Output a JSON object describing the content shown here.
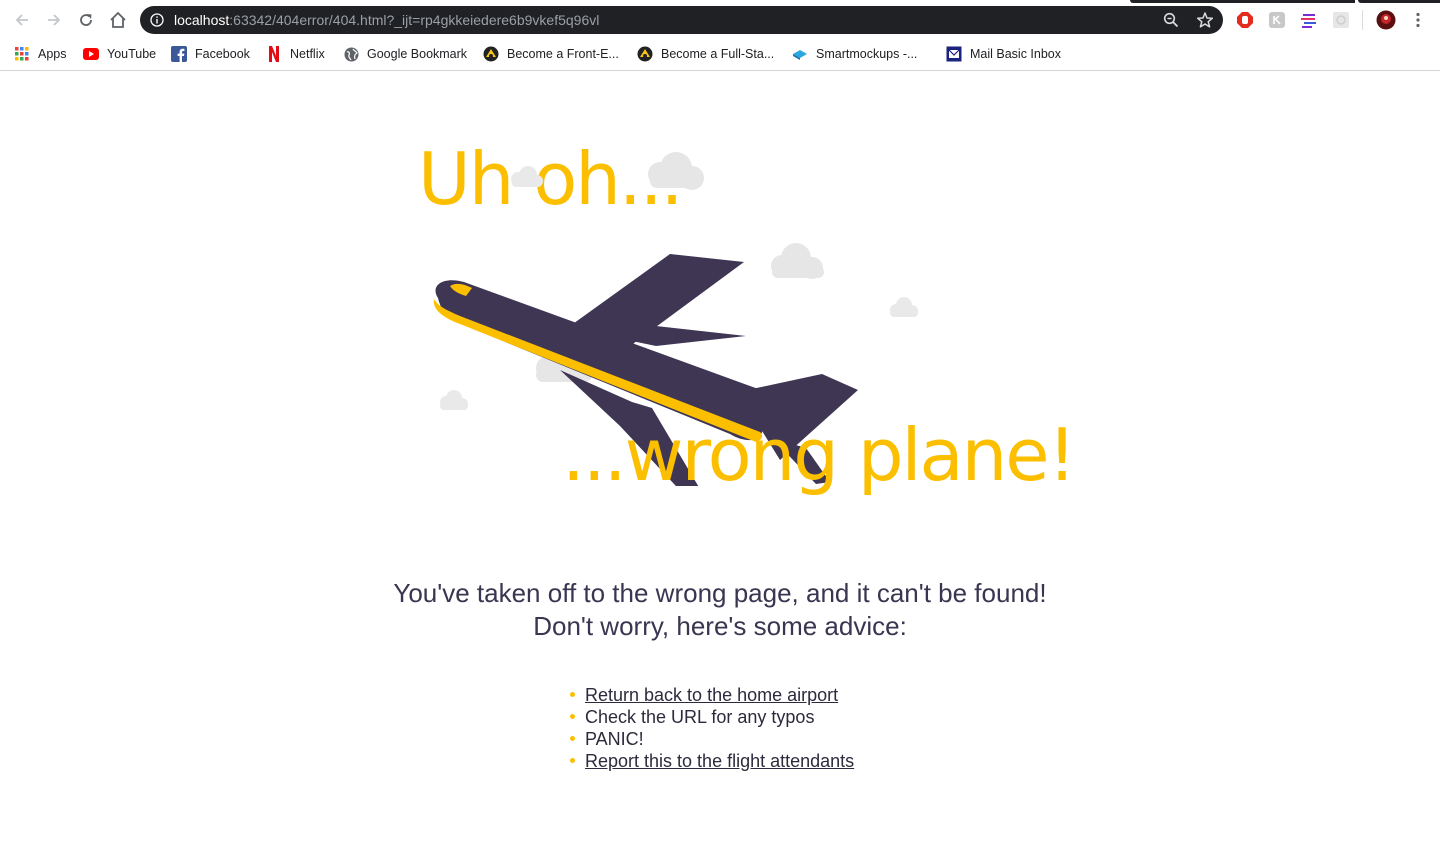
{
  "browser": {
    "url_host": "localhost",
    "url_rest": ":63342/404error/404.html?_ijt=rp4gkkeiedere6b9vkef5q96vl",
    "icons": [
      "back-icon",
      "forward-icon",
      "reload-icon",
      "home-icon",
      "info-icon",
      "zoom-icon",
      "star-icon",
      "menu-icon"
    ]
  },
  "bookmarks": [
    {
      "label": "Apps",
      "icon": "apps-grid-icon"
    },
    {
      "label": "YouTube",
      "icon": "youtube-icon"
    },
    {
      "label": "Facebook",
      "icon": "facebook-icon"
    },
    {
      "label": "Netflix",
      "icon": "netflix-icon"
    },
    {
      "label": "Google Bookmark",
      "icon": "globe-icon"
    },
    {
      "label": "Become a Front-E...",
      "icon": "site-icon"
    },
    {
      "label": "Become a Full-Sta...",
      "icon": "site-icon"
    },
    {
      "label": "Smartmockups -...",
      "icon": "smartmockups-icon"
    },
    {
      "label": "Mail Basic Inbox",
      "icon": "mail-icon"
    }
  ],
  "page": {
    "headline_top": "Uh oh...",
    "headline_bottom": "...wrong plane!",
    "message_line1": "You've taken off to the wrong page, and it can't be found!",
    "message_line2": "Don't worry, here's some advice:",
    "advice": [
      {
        "text": "Return back to the home airport",
        "link": true
      },
      {
        "text": "Check the URL for any typos",
        "link": false
      },
      {
        "text": "PANIC!",
        "link": false
      },
      {
        "text": "Report this to the flight attendants",
        "link": true
      }
    ]
  },
  "colors": {
    "accent": "#fbbf00",
    "plane_body": "#3f3654",
    "text": "#3a3550",
    "cloud": "#e4e4e4"
  }
}
